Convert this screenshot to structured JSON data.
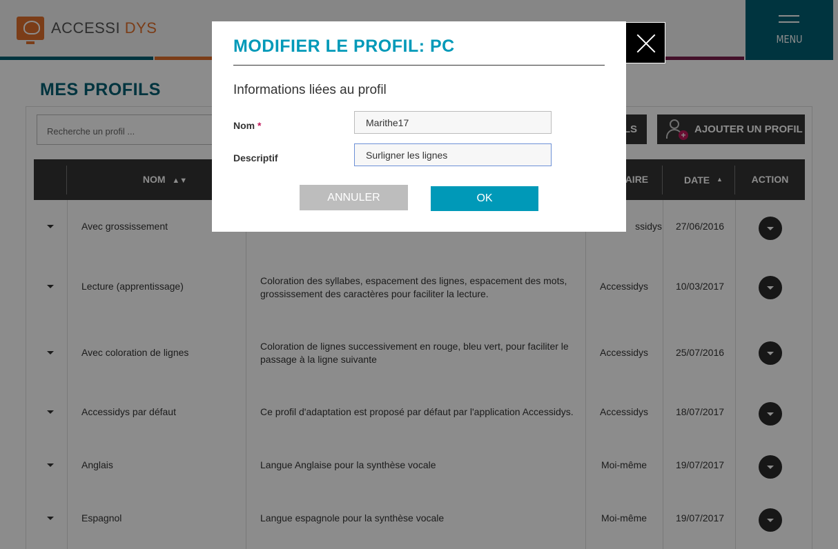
{
  "header": {
    "logo_text_a": "ACCESSI",
    "logo_text_b": "DYS",
    "menu_label": "MENU",
    "bar_colors": [
      "#005f73",
      "#e0702c",
      "#7a1f4d"
    ]
  },
  "page": {
    "title": "MES PROFILS",
    "search_placeholder": "Recherche un profil ...",
    "profils_btn_label": "LS",
    "add_btn_label": "AJOUTER UN PROFIL"
  },
  "table": {
    "headers": {
      "nom": "NOM",
      "proprietaire": "ÉTAIRE",
      "date": "DATE",
      "action": "ACTION"
    },
    "rows": [
      {
        "nom": "Avec grossissement",
        "description": "",
        "proprietaire": "ssidys",
        "date": "27/06/2016"
      },
      {
        "nom": "Lecture (apprentissage)",
        "description": "Coloration des syllabes, espacement des lignes, espacement des mots, grossissement des caractères pour faciliter la lecture.",
        "proprietaire": "Accessidys",
        "date": "10/03/2017"
      },
      {
        "nom": "Avec coloration de lignes",
        "description": "Coloration de lignes successivement en rouge, bleu vert, pour faciliter le passage à la ligne suivante",
        "proprietaire": "Accessidys",
        "date": "25/07/2016"
      },
      {
        "nom": "Accessidys par défaut",
        "description": "Ce profil d'adaptation est proposé par défaut par l'application Accessidys.",
        "proprietaire": "Accessidys",
        "date": "18/07/2017"
      },
      {
        "nom": "Anglais",
        "description": "Langue Anglaise pour la synthèse vocale",
        "proprietaire": "Moi-même",
        "date": "19/07/2017"
      },
      {
        "nom": "Espagnol",
        "description": "Langue espagnole pour la synthèse vocale",
        "proprietaire": "Moi-même",
        "date": "19/07/2017"
      }
    ]
  },
  "modal": {
    "title": "MODIFIER LE PROFIL: PC",
    "subtitle": "Informations liées au profil",
    "nom_label": "Nom",
    "required_mark": "*",
    "nom_value": "Marithe17",
    "descriptif_label": "Descriptif",
    "descriptif_value": "Surligner les lignes",
    "cancel_label": "ANNULER",
    "ok_label": "OK"
  },
  "colors": {
    "accent": "#0099b8",
    "brand_dark": "#005f73",
    "brand_orange": "#e0702c"
  }
}
